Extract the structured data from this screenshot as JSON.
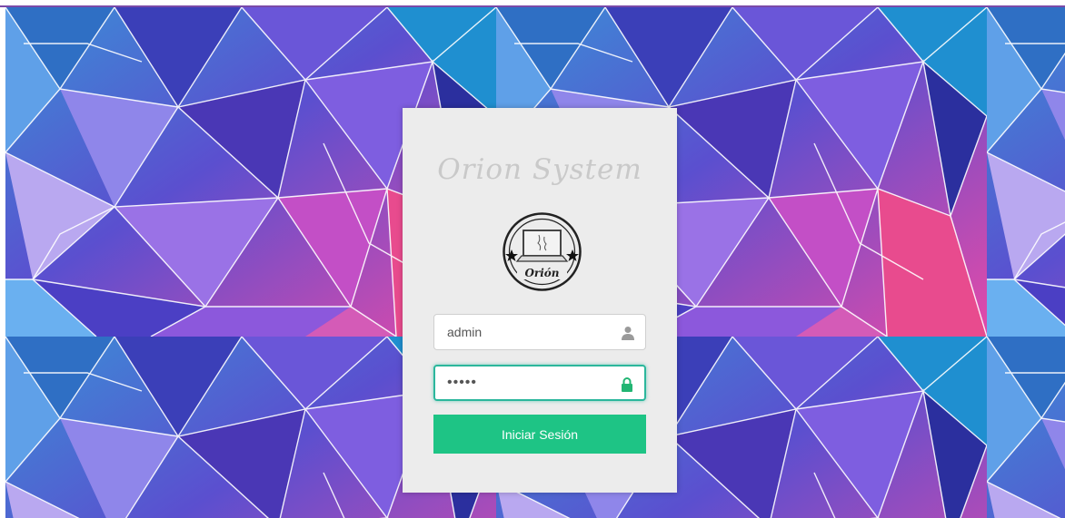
{
  "brand": {
    "title": "Orion System",
    "logo_text": "Orión"
  },
  "login": {
    "username_value": "admin",
    "password_value": "•••••",
    "submit_label": "Iniciar Sesión"
  },
  "icons": {
    "username": "user-icon",
    "password": "lock-icon"
  },
  "colors": {
    "accent": "#1ec485",
    "focus_border": "#2bb79c",
    "card_bg": "#ececec"
  }
}
